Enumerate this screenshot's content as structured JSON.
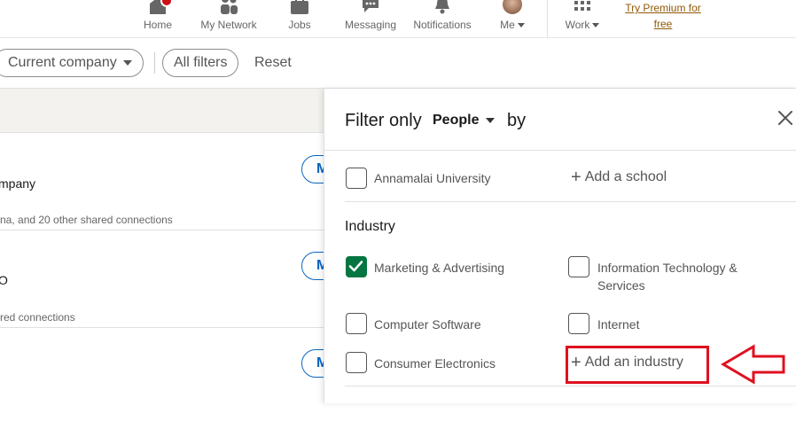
{
  "nav": {
    "items": [
      {
        "label": "Home",
        "icon": "home-icon"
      },
      {
        "label": "My Network",
        "icon": "network-icon"
      },
      {
        "label": "Jobs",
        "icon": "briefcase-icon"
      },
      {
        "label": "Messaging",
        "icon": "chat-bubble-icon"
      },
      {
        "label": "Notifications",
        "icon": "bell-icon"
      },
      {
        "label": "Me",
        "icon": "avatar"
      },
      {
        "label": "Work",
        "icon": "grid-icon"
      }
    ],
    "premium_line1": "Try Premium for",
    "premium_line2": "free"
  },
  "filterbar": {
    "current_company": "Current company",
    "all_filters": "All filters",
    "reset": "Reset"
  },
  "results": [
    {
      "line1": "mpany",
      "line2": "na, and 20 other shared connections",
      "button": "M"
    },
    {
      "line1": "O",
      "line2": "red connections",
      "button": "M"
    },
    {
      "button": "M"
    }
  ],
  "panel": {
    "title_prefix": "Filter only",
    "entity": "People",
    "title_suffix": "by",
    "school_option": "Annamalai University",
    "add_school": "Add a school",
    "industry_label": "Industry",
    "industries": [
      {
        "label": "Marketing & Advertising",
        "checked": true
      },
      {
        "label": "Information Technology &",
        "label2": "Services",
        "checked": false
      },
      {
        "label": "Computer Software",
        "checked": false
      },
      {
        "label": "Internet",
        "checked": false
      },
      {
        "label": "Consumer Electronics",
        "checked": false
      }
    ],
    "add_industry": "Add an industry"
  },
  "annotation": {
    "highlight_color": "#e0101f",
    "arrow_color": "#e0101f"
  },
  "colors": {
    "linkedin_blue": "#0a66c2",
    "check_green": "#057642",
    "premium_gold": "#915907",
    "badge_red": "#cc1016"
  }
}
